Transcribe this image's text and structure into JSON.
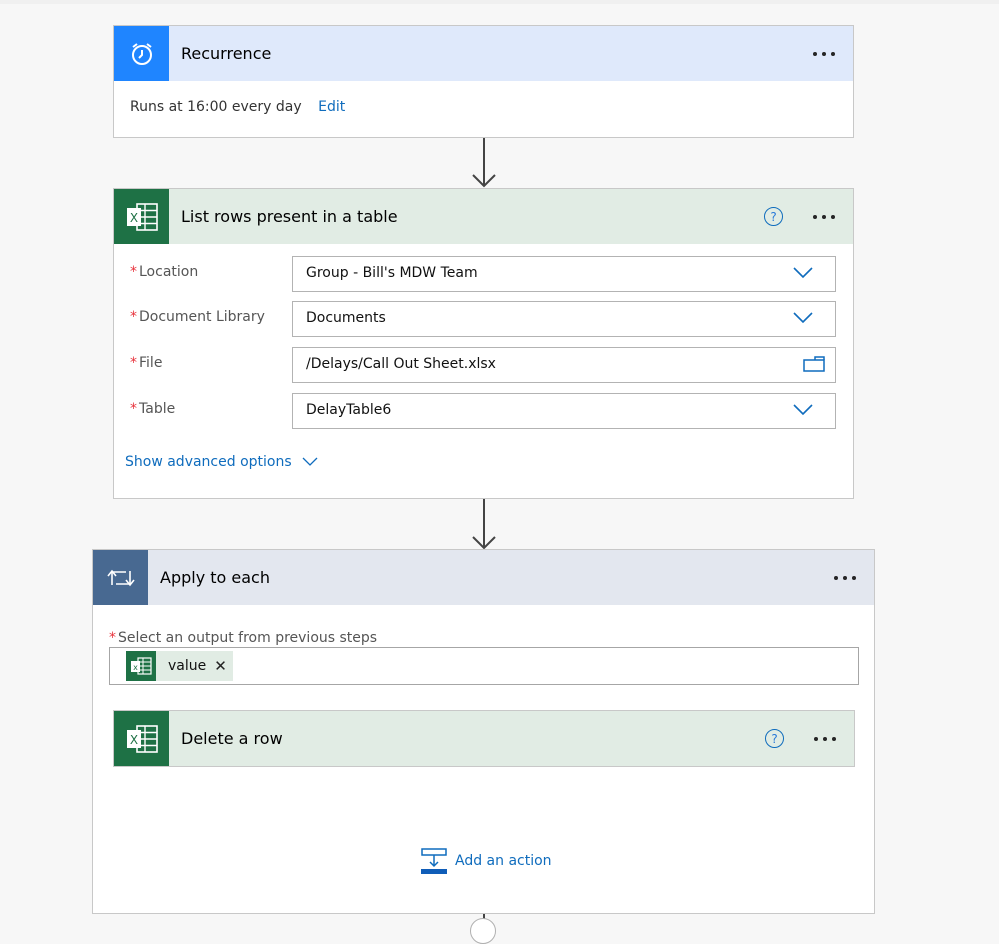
{
  "colors": {
    "recurrence_accent": "#1f85ff",
    "excel_accent": "#1e7145",
    "loop_accent": "#486991",
    "link": "#0f6cbd",
    "required": "#e8323c"
  },
  "recurrence": {
    "title": "Recurrence",
    "icon": "alarm-clock-icon",
    "summary": "Runs at 16:00 every day",
    "edit_label": "Edit"
  },
  "list_rows": {
    "title": "List rows present in a table",
    "icon": "excel-icon",
    "fields": [
      {
        "label": "Location",
        "required": "*",
        "value": "Group - Bill's MDW Team",
        "control": "dropdown"
      },
      {
        "label": "Document Library",
        "required": "*",
        "value": "Documents",
        "control": "dropdown"
      },
      {
        "label": "File",
        "required": "*",
        "value": "/Delays/Call Out Sheet.xlsx",
        "control": "file-picker"
      },
      {
        "label": "Table",
        "required": "*",
        "value": "DelayTable6",
        "control": "dropdown"
      }
    ],
    "advanced_label": "Show advanced options"
  },
  "apply_to_each": {
    "title": "Apply to each",
    "icon": "loop-icon",
    "select_label": "Select an output from previous steps",
    "required": "*",
    "token": {
      "label": "value",
      "icon": "excel-icon"
    },
    "inner_action": {
      "title": "Delete a row",
      "icon": "excel-icon"
    },
    "add_action_label": "Add an action"
  }
}
